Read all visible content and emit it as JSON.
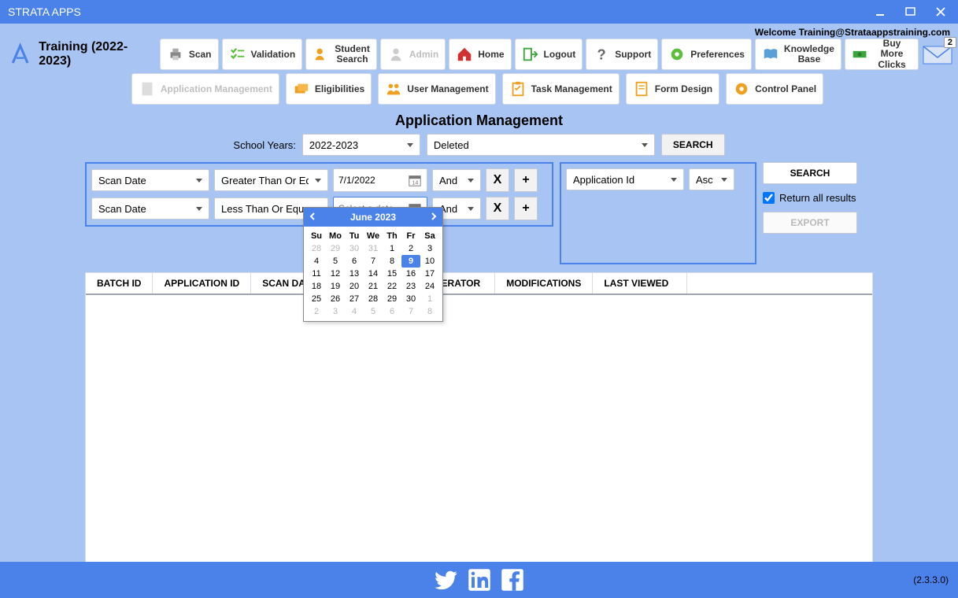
{
  "app_title": "STRATA APPS",
  "welcome_text": "Welcome Training@Strataappstraining.com",
  "training_label": "Training (2022-2023)",
  "notification_count": "2",
  "toolbar": {
    "scan": "Scan",
    "validation": "Validation",
    "student_search": "Student\nSearch",
    "admin": "Admin",
    "home": "Home",
    "logout": "Logout",
    "support": "Support",
    "preferences": "Preferences",
    "knowledge_base": "Knowledge\nBase",
    "buy_more_clicks": "Buy More\nClicks"
  },
  "secondary_toolbar": {
    "app_mgmt": "Application Management",
    "eligibilities": "Eligibilities",
    "user_mgmt": "User Management",
    "task_mgmt": "Task Management",
    "form_design": "Form Design",
    "control_panel": "Control Panel"
  },
  "page_title": "Application Management",
  "school_years_label": "School Years:",
  "school_year_value": "2022-2023",
  "status_value": "Deleted",
  "search_btn": "SEARCH",
  "filters": {
    "row1_field": "Scan Date",
    "row1_op": "Greater Than Or Equal",
    "row1_date": "7/1/2022",
    "row1_conj": "And",
    "row2_field": "Scan Date",
    "row2_op": "Less Than Or Equal",
    "row2_date_placeholder": "Select a date",
    "row2_conj": "And"
  },
  "sort": {
    "field": "Application Id",
    "dir": "Asc"
  },
  "right_col": {
    "search": "SEARCH",
    "return_all": "Return all results",
    "export": "EXPORT"
  },
  "calendar": {
    "title": "June 2023",
    "dow": [
      "Su",
      "Mo",
      "Tu",
      "We",
      "Th",
      "Fr",
      "Sa"
    ],
    "days": [
      {
        "d": "28",
        "o": 1
      },
      {
        "d": "29",
        "o": 1
      },
      {
        "d": "30",
        "o": 1
      },
      {
        "d": "31",
        "o": 1
      },
      {
        "d": "1"
      },
      {
        "d": "2"
      },
      {
        "d": "3"
      },
      {
        "d": "4"
      },
      {
        "d": "5"
      },
      {
        "d": "6"
      },
      {
        "d": "7"
      },
      {
        "d": "8"
      },
      {
        "d": "9",
        "t": 1
      },
      {
        "d": "10"
      },
      {
        "d": "11"
      },
      {
        "d": "12"
      },
      {
        "d": "13"
      },
      {
        "d": "14"
      },
      {
        "d": "15"
      },
      {
        "d": "16"
      },
      {
        "d": "17"
      },
      {
        "d": "18"
      },
      {
        "d": "19"
      },
      {
        "d": "20"
      },
      {
        "d": "21"
      },
      {
        "d": "22"
      },
      {
        "d": "23"
      },
      {
        "d": "24"
      },
      {
        "d": "25"
      },
      {
        "d": "26"
      },
      {
        "d": "27"
      },
      {
        "d": "28"
      },
      {
        "d": "29"
      },
      {
        "d": "30"
      },
      {
        "d": "1",
        "o": 1
      },
      {
        "d": "2",
        "o": 1
      },
      {
        "d": "3",
        "o": 1
      },
      {
        "d": "4",
        "o": 1
      },
      {
        "d": "5",
        "o": 1
      },
      {
        "d": "6",
        "o": 1
      },
      {
        "d": "7",
        "o": 1
      },
      {
        "d": "8",
        "o": 1
      }
    ]
  },
  "columns": [
    "BATCH ID",
    "APPLICATION ID",
    "SCAN DATE",
    "OPERATOR",
    "MODIFICATIONS",
    "LAST VIEWED"
  ],
  "version": "(2.3.3.0)"
}
